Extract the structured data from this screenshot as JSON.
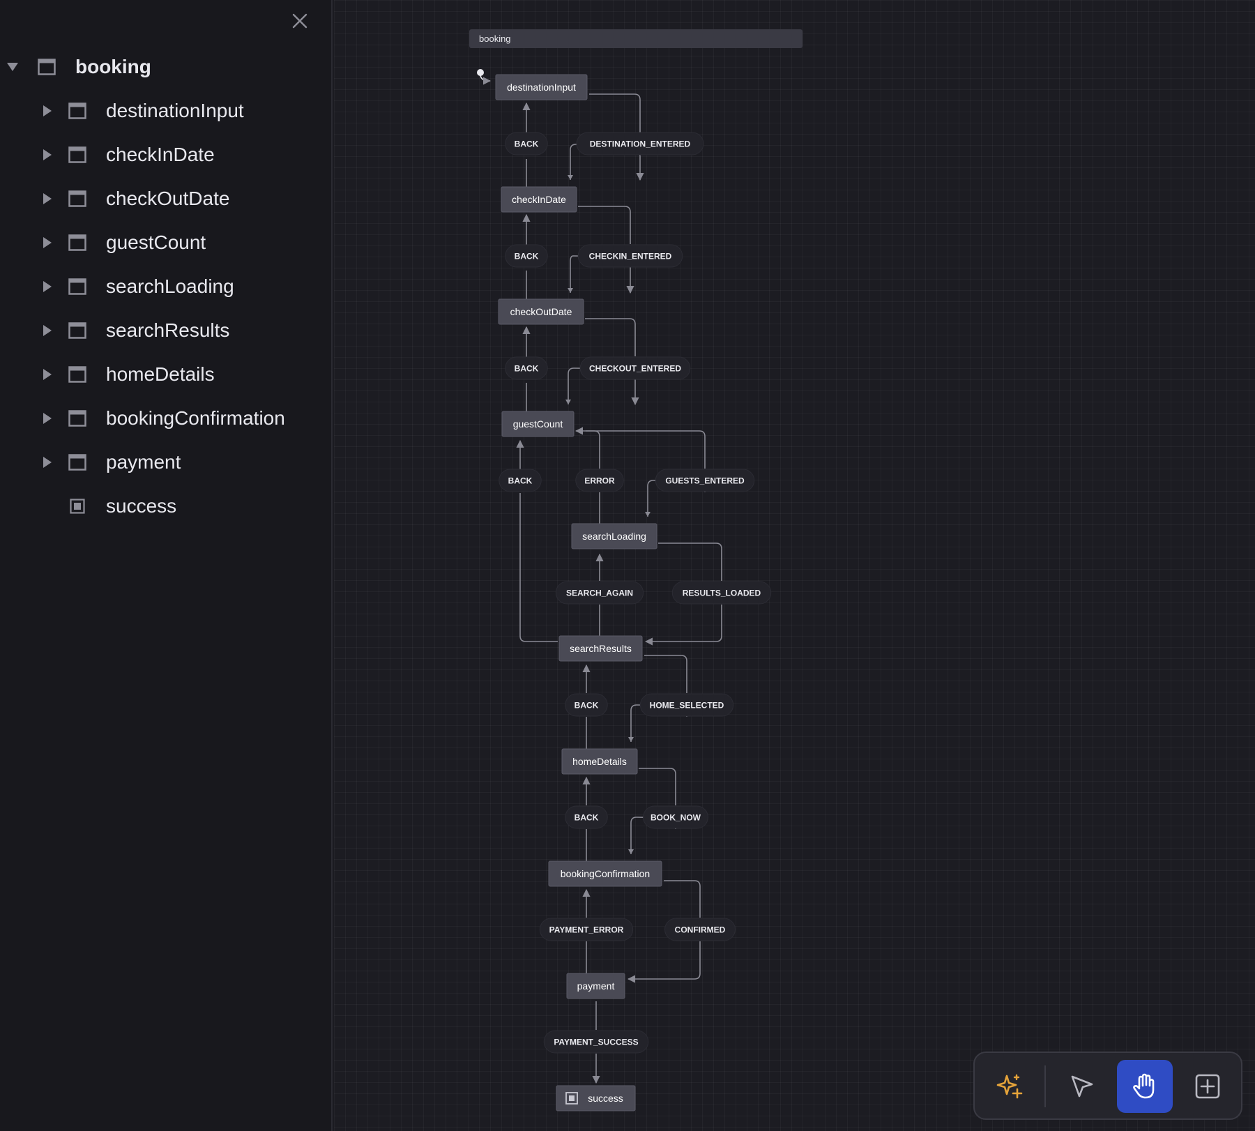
{
  "sidebar": {
    "root": {
      "label": "booking",
      "icon": "window-icon",
      "expanded": true
    },
    "items": [
      {
        "label": "destinationInput",
        "icon": "window-icon",
        "has_children": true
      },
      {
        "label": "checkInDate",
        "icon": "window-icon",
        "has_children": true
      },
      {
        "label": "checkOutDate",
        "icon": "window-icon",
        "has_children": true
      },
      {
        "label": "guestCount",
        "icon": "window-icon",
        "has_children": true
      },
      {
        "label": "searchLoading",
        "icon": "window-icon",
        "has_children": true
      },
      {
        "label": "searchResults",
        "icon": "window-icon",
        "has_children": true
      },
      {
        "label": "homeDetails",
        "icon": "window-icon",
        "has_children": true
      },
      {
        "label": "bookingConfirmation",
        "icon": "window-icon",
        "has_children": true
      },
      {
        "label": "payment",
        "icon": "window-icon",
        "has_children": true
      },
      {
        "label": "success",
        "icon": "final-state-icon",
        "has_children": false
      }
    ]
  },
  "diagram": {
    "machine_label": "booking",
    "states": [
      {
        "id": "destinationInput",
        "label": "destinationInput",
        "initial": true
      },
      {
        "id": "checkInDate",
        "label": "checkInDate"
      },
      {
        "id": "checkOutDate",
        "label": "checkOutDate"
      },
      {
        "id": "guestCount",
        "label": "guestCount"
      },
      {
        "id": "searchLoading",
        "label": "searchLoading"
      },
      {
        "id": "searchResults",
        "label": "searchResults"
      },
      {
        "id": "homeDetails",
        "label": "homeDetails"
      },
      {
        "id": "bookingConfirmation",
        "label": "bookingConfirmation"
      },
      {
        "id": "payment",
        "label": "payment"
      },
      {
        "id": "success",
        "label": "success",
        "final": true
      }
    ],
    "transitions": [
      {
        "event": "DESTINATION_ENTERED",
        "from": "destinationInput",
        "to": "checkInDate"
      },
      {
        "event": "BACK",
        "from": "checkInDate",
        "to": "destinationInput"
      },
      {
        "event": "CHECKIN_ENTERED",
        "from": "checkInDate",
        "to": "checkOutDate"
      },
      {
        "event": "BACK",
        "from": "checkOutDate",
        "to": "checkInDate"
      },
      {
        "event": "CHECKOUT_ENTERED",
        "from": "checkOutDate",
        "to": "guestCount"
      },
      {
        "event": "BACK",
        "from": "guestCount",
        "to": "checkOutDate"
      },
      {
        "event": "GUESTS_ENTERED",
        "from": "guestCount",
        "to": "searchLoading"
      },
      {
        "event": "ERROR",
        "from": "searchLoading",
        "to": "guestCount"
      },
      {
        "event": "BACK",
        "from": "searchResults",
        "to": "guestCount"
      },
      {
        "event": "RESULTS_LOADED",
        "from": "searchLoading",
        "to": "searchResults"
      },
      {
        "event": "SEARCH_AGAIN",
        "from": "searchResults",
        "to": "searchLoading"
      },
      {
        "event": "HOME_SELECTED",
        "from": "searchResults",
        "to": "homeDetails"
      },
      {
        "event": "BACK",
        "from": "homeDetails",
        "to": "searchResults"
      },
      {
        "event": "BOOK_NOW",
        "from": "homeDetails",
        "to": "bookingConfirmation"
      },
      {
        "event": "BACK",
        "from": "bookingConfirmation",
        "to": "homeDetails"
      },
      {
        "event": "CONFIRMED",
        "from": "bookingConfirmation",
        "to": "payment"
      },
      {
        "event": "PAYMENT_ERROR",
        "from": "payment",
        "to": "bookingConfirmation"
      },
      {
        "event": "PAYMENT_SUCCESS",
        "from": "payment",
        "to": "success"
      }
    ]
  },
  "toolbar": {
    "tools": [
      {
        "name": "ai-sparkles-icon",
        "active": false
      },
      {
        "name": "pointer-icon",
        "active": false
      },
      {
        "name": "hand-icon",
        "active": true
      },
      {
        "name": "add-state-icon",
        "active": false
      }
    ]
  },
  "colors": {
    "background": "#1c1c22",
    "sidebar": "#18181d",
    "state_fill": "#4a4a55",
    "event_fill": "#23232a",
    "edge": "#8a8a94",
    "active_tool": "#2f4cc4",
    "sparkle": "#e6a43a"
  }
}
